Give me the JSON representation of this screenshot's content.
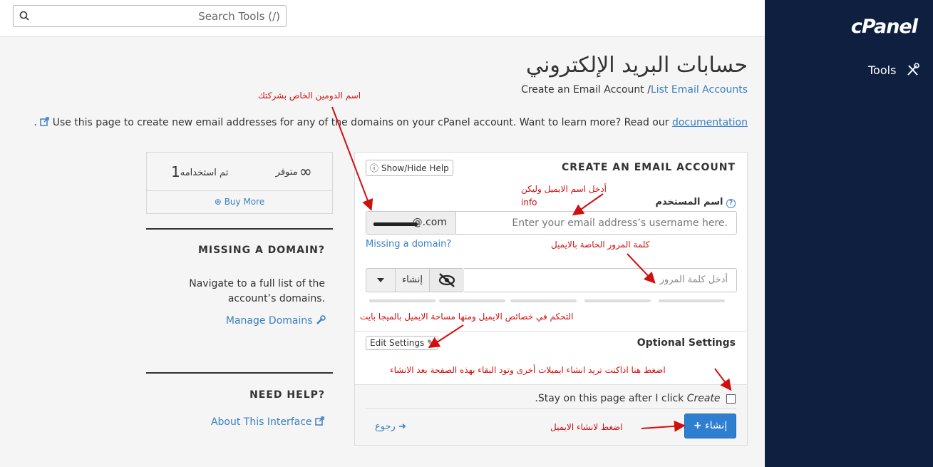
{
  "search": {
    "placeholder": "Search Tools (/)"
  },
  "sidebar": {
    "logo": "cPanel",
    "tools_label": "Tools"
  },
  "page": {
    "title": "حسابات البريد الإلكتروني",
    "crumb_current": "Create an Email Account",
    "crumb_link": "List Email Accounts",
    "crumb_sep": " /",
    "intro_text": "Use this page to create new email addresses for any of the domains on your cPanel account. Want to learn more? Read our ",
    "intro_link": "documentation",
    "intro_end": "."
  },
  "stats": {
    "available_value": "∞",
    "available_label": "متوفر",
    "used_value": "1",
    "used_label": "تم استخدامه",
    "buy_more": "Buy More"
  },
  "missing_domain": {
    "heading": "MISSING A DOMAIN?",
    "text": "Navigate to a full list of the account’s domains.",
    "link": "Manage Domains"
  },
  "need_help": {
    "heading": "NEED HELP?",
    "link": "About This Interface"
  },
  "form": {
    "title": "CREATE AN EMAIL ACCOUNT",
    "show_hide_help": "Show/Hide Help",
    "username_label": "اسم المستخدم",
    "domain_suffix": "@.com",
    "username_placeholder": "Enter your email address’s username here.",
    "missing_link": "Missing a domain?",
    "password_placeholder": "أدخل كلمة المرور",
    "generate_label": "إنشاء",
    "optional_settings": "Optional Settings",
    "edit_settings": "Edit Settings",
    "stay_text": "Stay on this page after I click",
    "stay_em": "Create",
    "stay_end": ".",
    "create_button": "إنشاء",
    "back_button": "رجوع"
  },
  "annotations": {
    "domain": "اسم الدومين الخاص بشركتك",
    "username_1": "أدخل اسم الايميل وليكن",
    "username_2": "info",
    "password": "كلمة المرور الخاصة بالايميل",
    "settings": "التحكم في خصائص الايميل ومنها مساحة الايميل بالميجا بايت",
    "stay": "اضغط هنا اذاكنت تريد انشاء  ايميلات أخرى وتود البقاء بهذه الصفحة بعد الانشاء",
    "create": "اضغط لانشاء  الايميل"
  },
  "colors": {
    "sidebar_bg": "#0e1f40",
    "link": "#3a80c2",
    "primary_button": "#2f7fd1",
    "annotation": "#d01010"
  }
}
